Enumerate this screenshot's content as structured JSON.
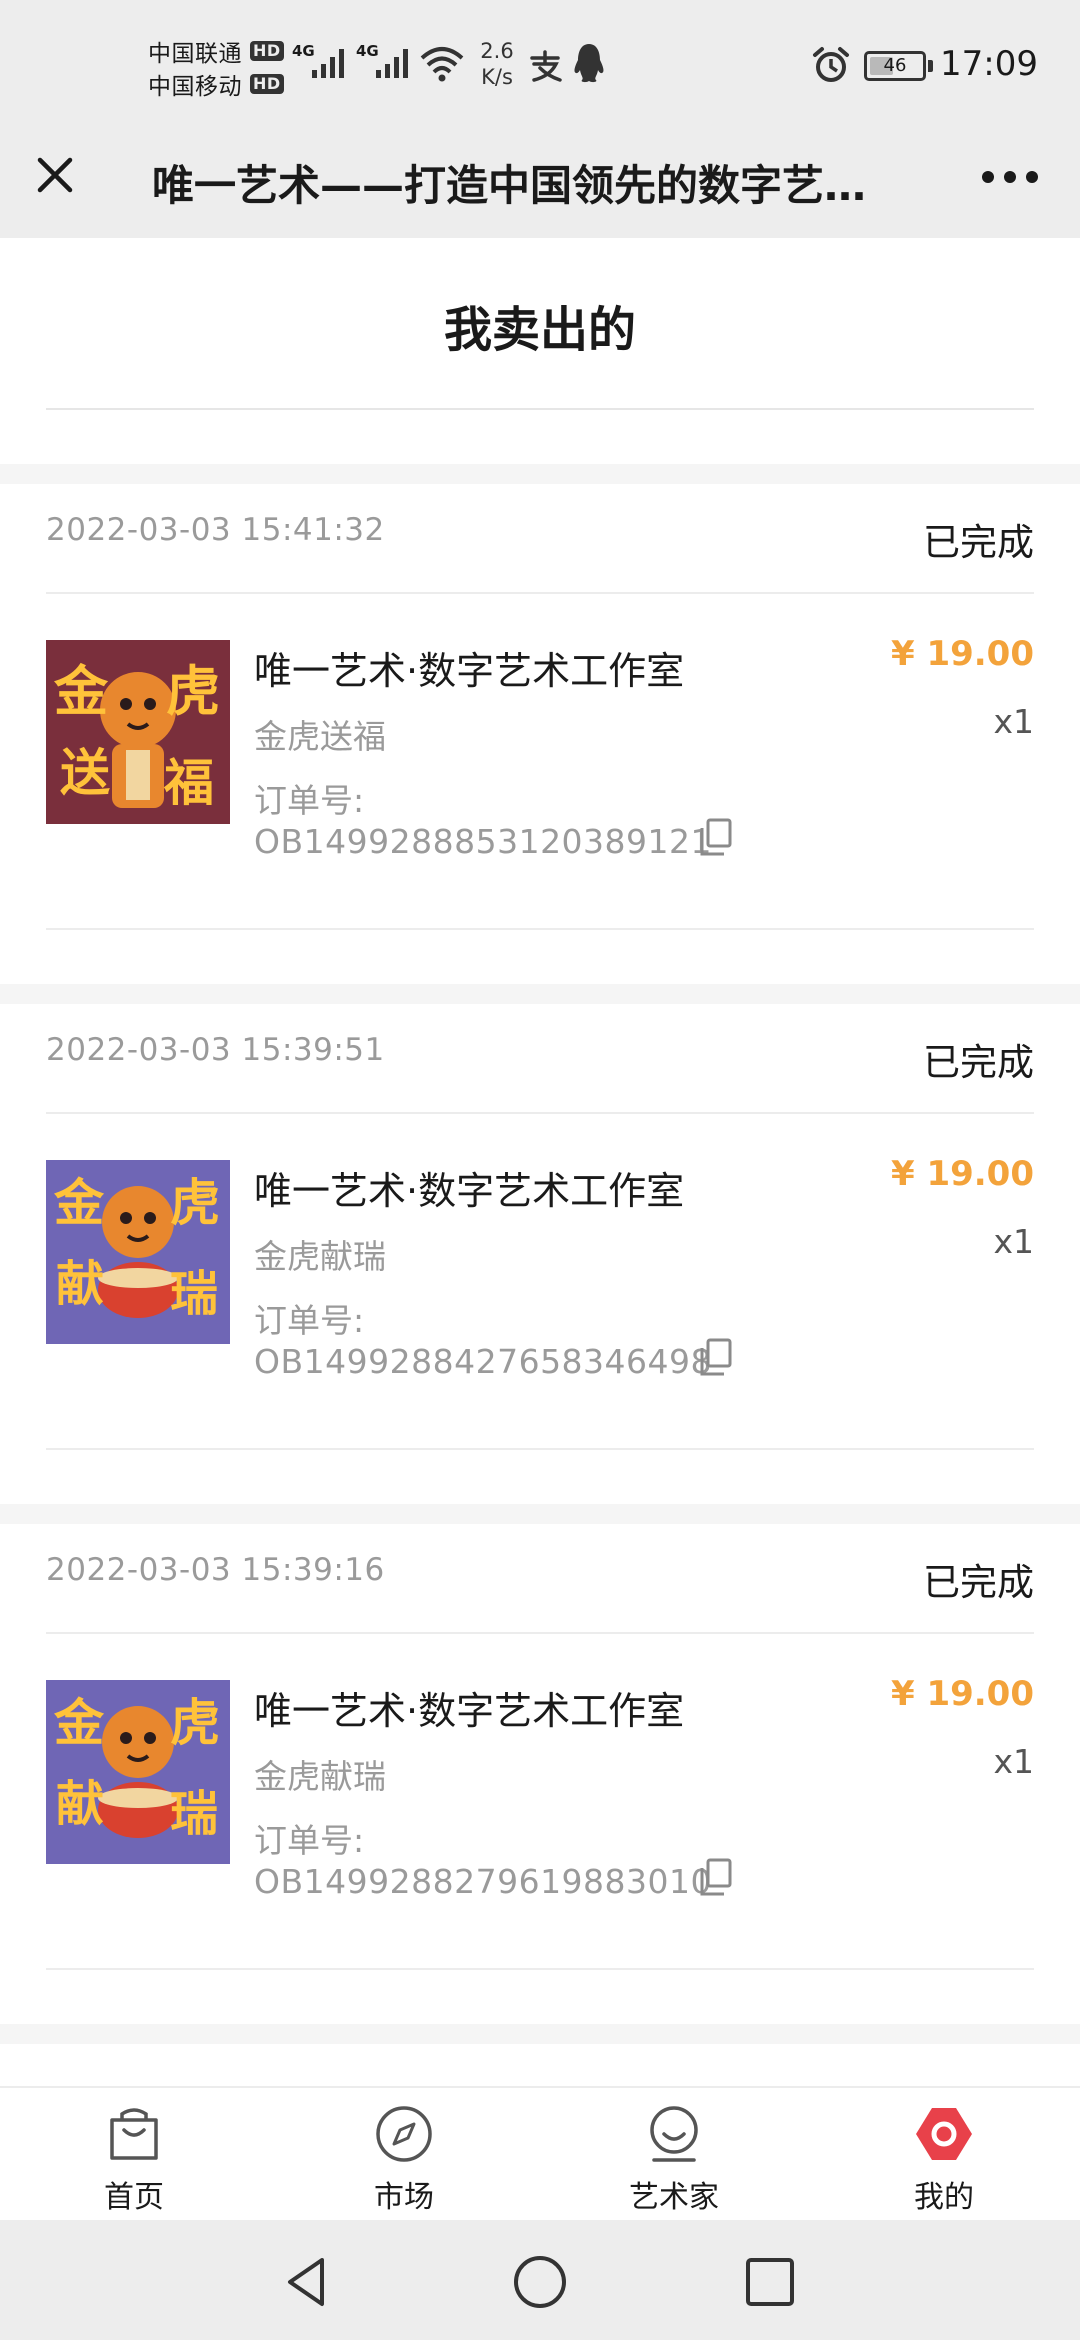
{
  "status_bar": {
    "carrier_1": "中国联通",
    "carrier_2": "中国移动",
    "hd_badge": "HD",
    "network_1": "4G",
    "network_2": "4G",
    "net_speed_value": "2.6",
    "net_speed_unit": "K/s",
    "battery_level": "46",
    "battery_fraction": 0.46,
    "time": "17:09",
    "icons": [
      "wifi-icon",
      "alipay-icon",
      "qq-icon",
      "alarm-icon"
    ]
  },
  "title_bar": {
    "title": "唯一艺术——打造中国领先的数字艺术平台",
    "close_icon": "close-icon",
    "more_icon": "more-icon"
  },
  "page": {
    "title": "我卖出的"
  },
  "orders": [
    {
      "time": "2022-03-03 15:41:32",
      "status": "已完成",
      "shop": "唯一艺术·数字艺术工作室",
      "product": "金虎送福",
      "order_no_label": "订单号:",
      "order_no": "OB1499288853120389121",
      "price": "¥ 19.00",
      "quantity": "x1",
      "art_text": [
        "金",
        "虎",
        "送",
        "福"
      ],
      "bg_color": "#7a2f3c"
    },
    {
      "time": "2022-03-03 15:39:51",
      "status": "已完成",
      "shop": "唯一艺术·数字艺术工作室",
      "product": "金虎献瑞",
      "order_no_label": "订单号:",
      "order_no": "OB1499288427658346498",
      "price": "¥ 19.00",
      "quantity": "x1",
      "art_text": [
        "金",
        "虎",
        "献",
        "瑞"
      ],
      "bg_color": "#6f66b5"
    },
    {
      "time": "2022-03-03 15:39:16",
      "status": "已完成",
      "shop": "唯一艺术·数字艺术工作室",
      "product": "金虎献瑞",
      "order_no_label": "订单号:",
      "order_no": "OB1499288279619883010",
      "price": "¥ 19.00",
      "quantity": "x1",
      "art_text": [
        "金",
        "虎",
        "献",
        "瑞"
      ],
      "bg_color": "#6f66b5"
    }
  ],
  "bottom_nav": {
    "items": [
      {
        "label": "首页",
        "icon": "shopping-bag-icon",
        "active": false
      },
      {
        "label": "市场",
        "icon": "compass-icon",
        "active": false
      },
      {
        "label": "艺术家",
        "icon": "artist-icon",
        "active": false
      },
      {
        "label": "我的",
        "icon": "profile-icon",
        "active": true
      }
    ]
  },
  "colors": {
    "accent_price": "#f3a33b",
    "active_tab": "#e8414a",
    "bar_gray": "#ededed"
  }
}
